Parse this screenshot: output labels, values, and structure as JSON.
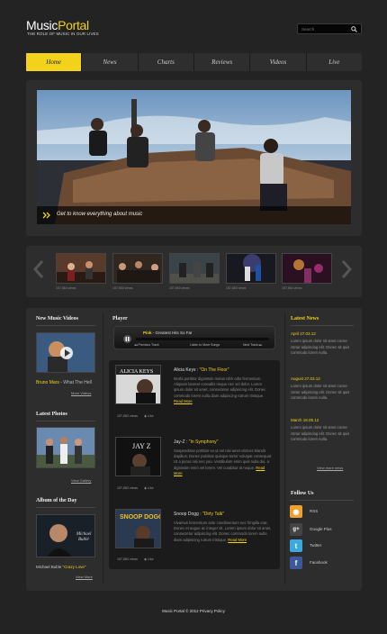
{
  "brand": {
    "name_part1": "Music",
    "name_part2": "Portal",
    "tagline": "THE ROLE OF MUSIC IN OUR LIVES"
  },
  "search": {
    "placeholder": "Search"
  },
  "nav": {
    "items": [
      "Home",
      "News",
      "Charts",
      "Reviews",
      "Videos",
      "Live"
    ],
    "active": "Home"
  },
  "hero": {
    "caption": "Get to know everything about music"
  },
  "thumbs": {
    "captions": [
      "157,863 views",
      "157,863 views",
      "157,863 views",
      "157,863 views",
      "157,863 views"
    ]
  },
  "left": {
    "new_videos": {
      "heading": "New Music Videos",
      "artist": "Bruno Mars",
      "song": "- What The Hell",
      "link": "More Videos"
    },
    "latest_photos": {
      "heading": "Latest Photos",
      "link": "View Gallery"
    },
    "album_of_day": {
      "heading": "Album of the Day",
      "artist": "Michael Buble",
      "album": "\"Crazy Love\"",
      "link": "View More"
    }
  },
  "player": {
    "heading": "Player",
    "now_playing_artist": "Pink",
    "now_playing_title": " - Greatest Hits So Far",
    "prev_label": "Previous Track",
    "listen_label": "Listen to More Songs",
    "next_label": "Next Track"
  },
  "songs": [
    {
      "artist": "Alicia Keys : ",
      "title": "\"On The Floor\"",
      "desc": "Morbi porttitor dignissim metus nibh odio fermentum. Aliquam laoreet convallis neque nec vel dolor. Lorem ipsum dolor sit amet, consectetur adipiscing elit. Donec commodo lorem nulla diam adipiscing rutrum tristique.",
      "more": "Read More",
      "views": "157,863 views",
      "like": "Like"
    },
    {
      "artist": "Jay-Z : ",
      "title": "\"In Symphony\"",
      "desc": "Suspendisse porttitor ex ut vel nisi amet ultrices blandit dapibus. Donec pulvinar quisque tortor volutpat consequat. Ut a purus nisi nec you. Vestibulum enim quis nulla dui, a dignissim enim vel lorem. Vel curabitur at neque.",
      "more": "Read More",
      "views": "157,863 views",
      "like": "Like"
    },
    {
      "artist": "Snoop Dogg : ",
      "title": "\"Dirty Talk\"",
      "desc": "Vivamus fermentum ante condimentum nec fringilla erat. Donec et augue ac integer sit. Lorem ipsum dolor sit amet, consectetur adipiscing elit. Donec commodo lorem nulla diam adipiscing rutrum tristique.",
      "more": "Read More",
      "views": "157,863 views",
      "like": "Like"
    }
  ],
  "news": {
    "heading": "Latest News",
    "items": [
      {
        "date": "April 27.03.12",
        "text": "Lorem ipsum dolor sit amet conse ctetur adipiscing elit. Donec sit quis commodo lorem nulla."
      },
      {
        "date": "August 27.03.12",
        "text": "Lorem ipsum dolor sit amet conse ctetur adipiscing elit. Donec sit quis commodo lorem nulla."
      },
      {
        "date": "March 18.05.12",
        "text": "Lorem ipsum dolor sit amet conse ctetur adipiscing elit. Donec sit quis commodo lorem nulla."
      }
    ],
    "link": "View more news"
  },
  "follow": {
    "heading": "Follow Us",
    "items": [
      {
        "label": "RSS",
        "icon": "rss-icon",
        "color": "#f0a030",
        "glyph": "◉"
      },
      {
        "label": "Google Plus",
        "icon": "google-plus-icon",
        "color": "#444444",
        "glyph": "g+"
      },
      {
        "label": "Twitter",
        "icon": "twitter-icon",
        "color": "#39a9e0",
        "glyph": "t"
      },
      {
        "label": "Facebook",
        "icon": "facebook-icon",
        "color": "#3b5998",
        "glyph": "f"
      }
    ]
  },
  "footer": {
    "text": "Music Portal © 2012 Privacy Policy"
  },
  "colors": {
    "accent": "#f2d21b",
    "background": "#232323",
    "panel": "#2d2d2d"
  }
}
